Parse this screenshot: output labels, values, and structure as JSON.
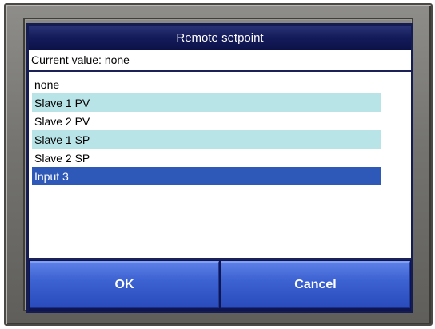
{
  "dialog": {
    "title": "Remote setpoint",
    "current_value_text": "Current value: none"
  },
  "options": [
    {
      "label": "none",
      "style": "plain"
    },
    {
      "label": "Slave 1 PV",
      "style": "alt"
    },
    {
      "label": "Slave 2 PV",
      "style": "plain"
    },
    {
      "label": "Slave 1 SP",
      "style": "alt"
    },
    {
      "label": "Slave 2 SP",
      "style": "plain"
    },
    {
      "label": "Input 3",
      "style": "selected"
    }
  ],
  "buttons": {
    "ok_label": "OK",
    "cancel_label": "Cancel"
  },
  "colors": {
    "title_bar": "#141b5a",
    "alt_row": "#b9e4e7",
    "selected_row": "#2f59b8",
    "button": "#3d62d2"
  }
}
